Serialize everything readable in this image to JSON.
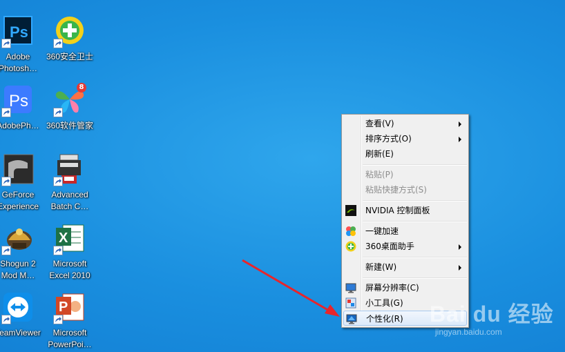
{
  "desktop": {
    "icons": [
      {
        "label1": "Adobe",
        "label2": "Photosh…"
      },
      {
        "label1": "360安全卫士",
        "label2": ""
      },
      {
        "label1": "AdobePh…",
        "label2": ""
      },
      {
        "label1": "360软件管家",
        "label2": ""
      },
      {
        "label1": "GeForce",
        "label2": "Experience"
      },
      {
        "label1": "Advanced",
        "label2": "Batch C…"
      },
      {
        "label1": "Shogun 2",
        "label2": "Mod M…"
      },
      {
        "label1": "Microsoft",
        "label2": "Excel 2010"
      },
      {
        "label1": "TeamViewer",
        "label2": ""
      },
      {
        "label1": "Microsoft",
        "label2": "PowerPoi…"
      }
    ],
    "badge_360_software": "8"
  },
  "context_menu": {
    "items": [
      {
        "label": "查看(V)"
      },
      {
        "label": "排序方式(O)"
      },
      {
        "label": "刷新(E)"
      },
      {
        "label": "粘贴(P)"
      },
      {
        "label": "粘贴快捷方式(S)"
      },
      {
        "label": "NVIDIA 控制面板"
      },
      {
        "label": "一键加速"
      },
      {
        "label": "360桌面助手"
      },
      {
        "label": "新建(W)"
      },
      {
        "label": "屏幕分辨率(C)"
      },
      {
        "label": "小工具(G)"
      },
      {
        "label": "个性化(R)"
      }
    ]
  },
  "watermark": {
    "logo": "Bai du 经验",
    "url": "jingyan.baidu.com"
  },
  "colors": {
    "desktop_bg": "#1a8fdf",
    "menu_bg": "#f0f0f0",
    "arrow": "#e8252b",
    "ps_icon": "#001e36",
    "ps_blue": "#31a8ff"
  }
}
